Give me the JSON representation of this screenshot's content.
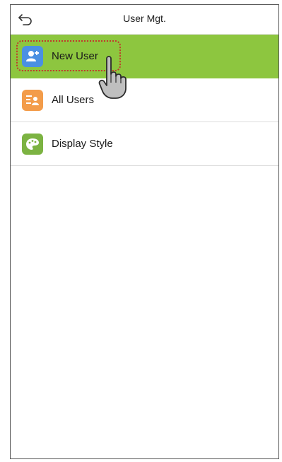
{
  "header": {
    "title": "User Mgt.",
    "back_icon": "back-arrow-icon"
  },
  "menu": {
    "items": [
      {
        "label": "New User",
        "icon": "add-user-icon",
        "icon_color": "#4a90e2",
        "selected": true
      },
      {
        "label": "All Users",
        "icon": "user-list-icon",
        "icon_color": "#f39c4a",
        "selected": false
      },
      {
        "label": "Display Style",
        "icon": "palette-icon",
        "icon_color": "#7cb342",
        "selected": false
      }
    ]
  },
  "colors": {
    "selected_row": "#8dc63f",
    "focus_ring": "#c0392b"
  },
  "pointer": {
    "icon": "hand-pointer-icon"
  }
}
